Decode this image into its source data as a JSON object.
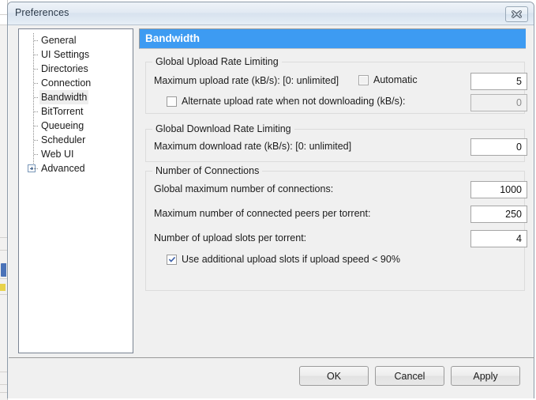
{
  "window": {
    "title": "Preferences",
    "close_icon": "close-x-icon"
  },
  "sidebar": {
    "items": [
      {
        "label": "General",
        "selected": false,
        "expandable": false
      },
      {
        "label": "UI Settings",
        "selected": false,
        "expandable": false
      },
      {
        "label": "Directories",
        "selected": false,
        "expandable": false
      },
      {
        "label": "Connection",
        "selected": false,
        "expandable": false
      },
      {
        "label": "Bandwidth",
        "selected": true,
        "expandable": false
      },
      {
        "label": "BitTorrent",
        "selected": false,
        "expandable": false
      },
      {
        "label": "Queueing",
        "selected": false,
        "expandable": false
      },
      {
        "label": "Scheduler",
        "selected": false,
        "expandable": false
      },
      {
        "label": "Web UI",
        "selected": false,
        "expandable": false
      },
      {
        "label": "Advanced",
        "selected": false,
        "expandable": true
      }
    ]
  },
  "main": {
    "header_title": "Bandwidth",
    "header_color": "#3d9bf2",
    "groups": {
      "upload": {
        "legend": "Global Upload Rate Limiting",
        "max_rate_label": "Maximum upload rate (kB/s): [0: unlimited]",
        "automatic_label": "Automatic",
        "automatic_checked": false,
        "max_rate_value": "5",
        "alternate_label": "Alternate upload rate when not downloading (kB/s):",
        "alternate_checked": false,
        "alternate_value": "0",
        "alternate_disabled": true
      },
      "download": {
        "legend": "Global Download Rate Limiting",
        "max_rate_label": "Maximum download rate (kB/s): [0: unlimited]",
        "max_rate_value": "0"
      },
      "connections": {
        "legend": "Number of Connections",
        "global_max_label": "Global maximum number of connections:",
        "global_max_value": "1000",
        "peers_label": "Maximum number of connected peers per torrent:",
        "peers_value": "250",
        "slots_label": "Number of upload slots per torrent:",
        "slots_value": "4",
        "additional_slots_label": "Use additional upload slots if upload speed < 90%",
        "additional_slots_checked": true
      }
    }
  },
  "footer": {
    "ok_label": "OK",
    "cancel_label": "Cancel",
    "apply_label": "Apply"
  }
}
